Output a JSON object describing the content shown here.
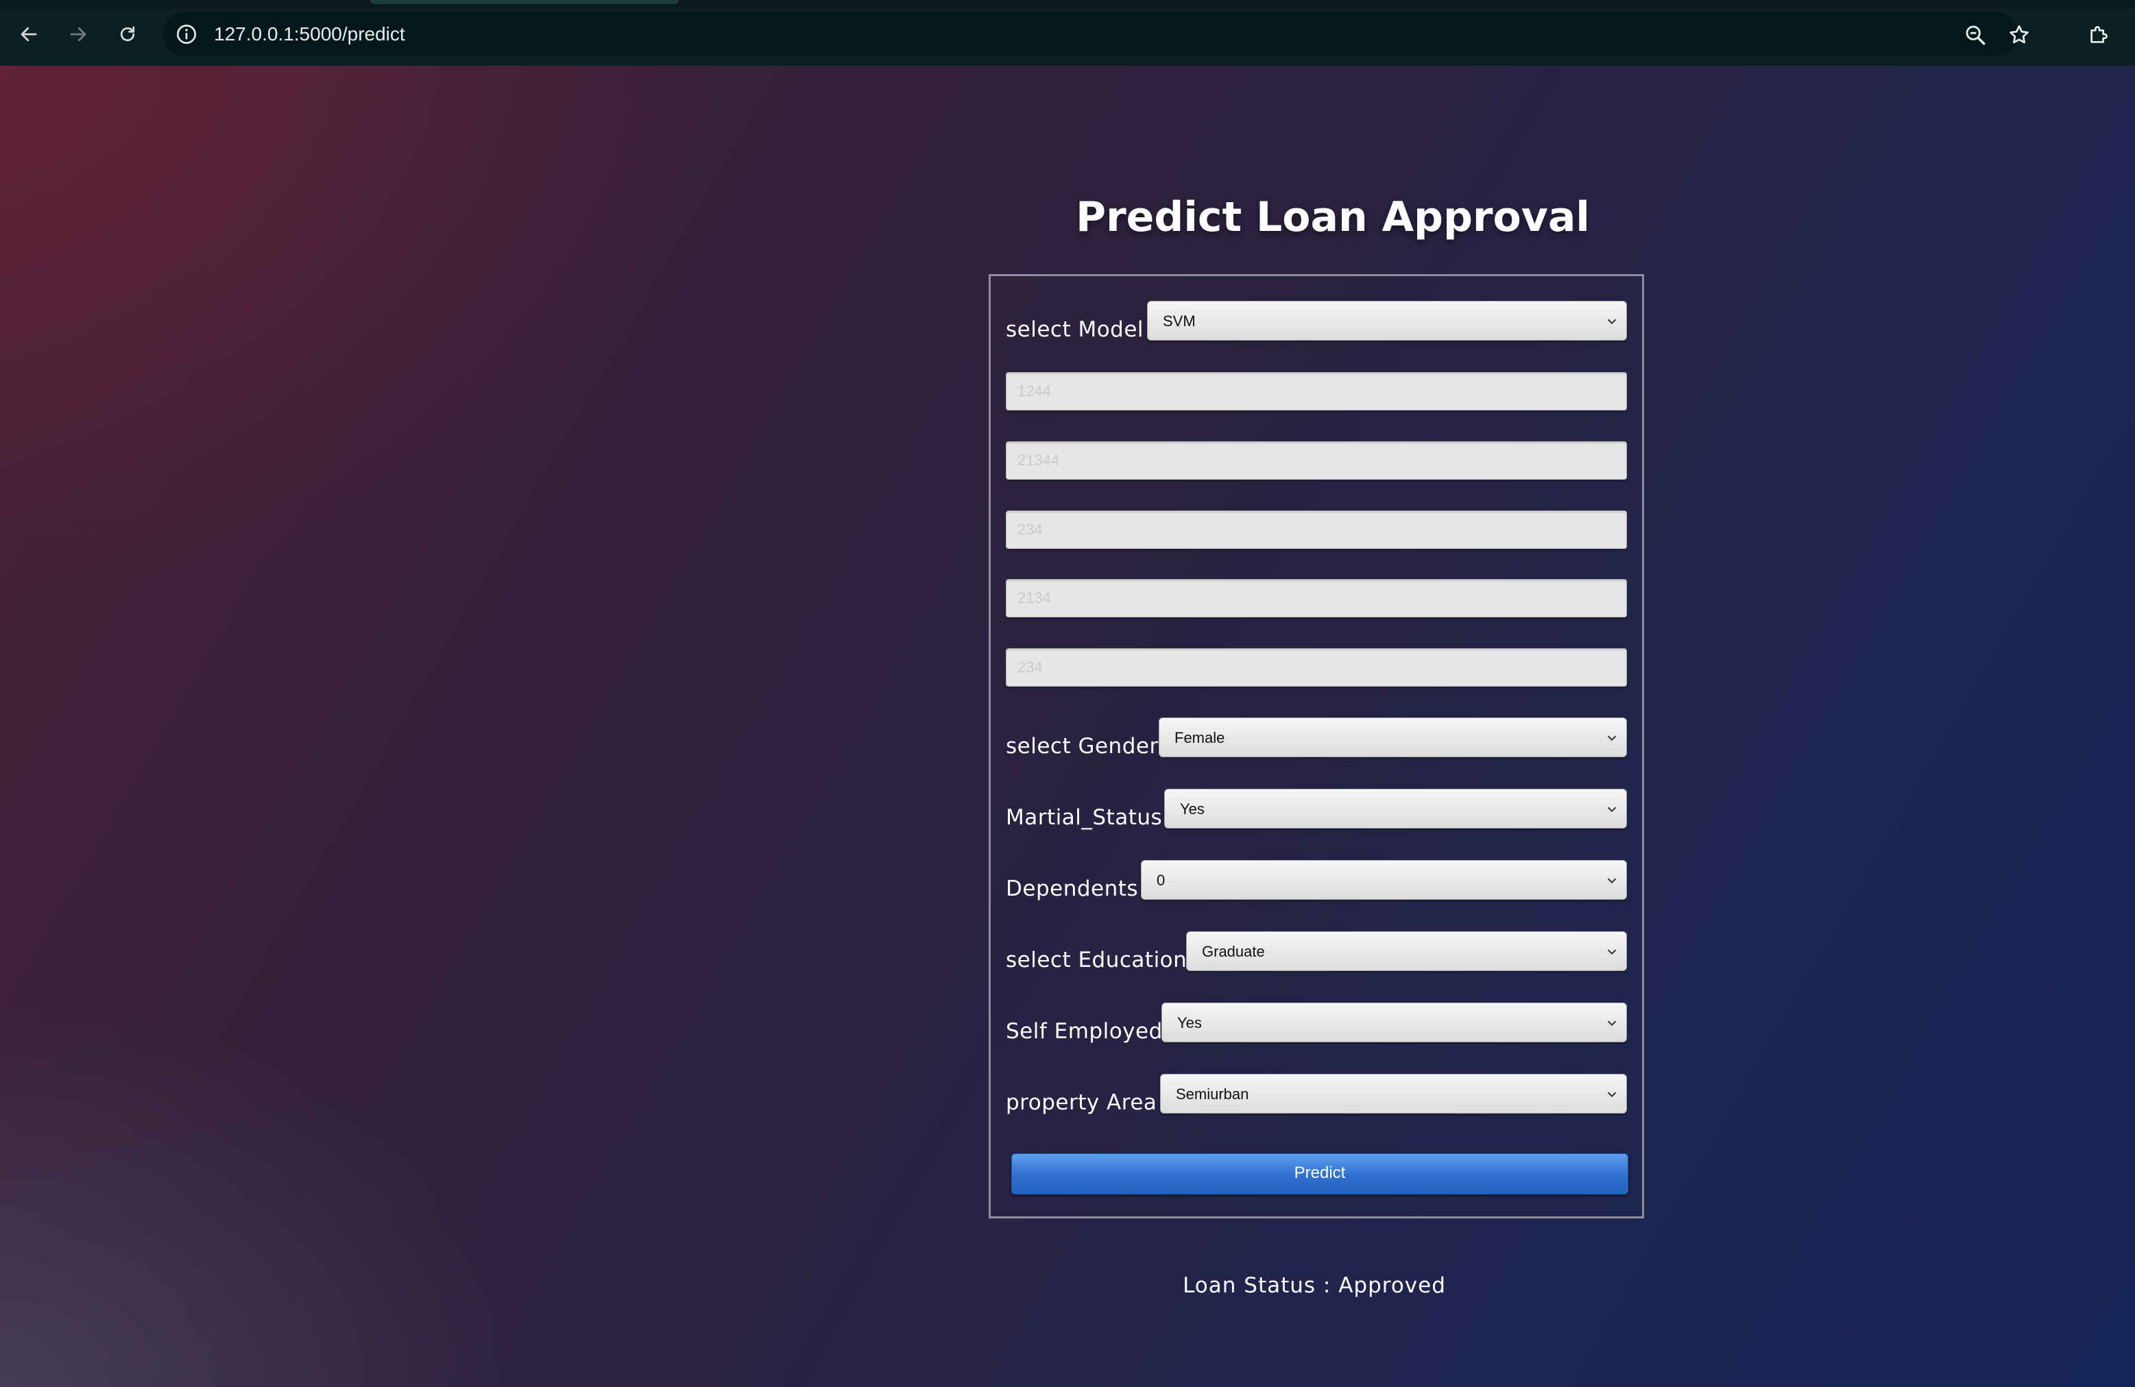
{
  "browser": {
    "url": "127.0.0.1:5000/predict"
  },
  "page": {
    "title": "Predict Loan Approval"
  },
  "form": {
    "model": {
      "label": "select Model",
      "value": "SVM"
    },
    "numeric_inputs": [
      {
        "placeholder": "1244"
      },
      {
        "placeholder": "21344"
      },
      {
        "placeholder": "234"
      },
      {
        "placeholder": "2134"
      },
      {
        "placeholder": "234"
      }
    ],
    "gender": {
      "label": "select Gender",
      "value": "Female"
    },
    "marital": {
      "label": "Martial_Status",
      "value": "Yes"
    },
    "dependents": {
      "label": "Dependents",
      "value": "0"
    },
    "education": {
      "label": "select Education",
      "value": "Graduate"
    },
    "self_employed": {
      "label": "Self Employed",
      "value": "Yes"
    },
    "property_area": {
      "label": "property Area",
      "value": "Semiurban"
    },
    "predict_label": "Predict"
  },
  "result": {
    "status_text": "Loan Status : Approved"
  },
  "icons": {
    "back": "arrow-left-icon",
    "forward": "arrow-right-icon",
    "reload": "reload-icon",
    "site_info": "info-icon",
    "zoom": "zoom-icon",
    "bookmark": "star-icon",
    "extensions": "puzzle-icon",
    "select_arrow": "chevron-down-icon"
  },
  "colors": {
    "chrome_bg": "#0c1f22",
    "omnibox_bg": "#04171a",
    "button_blue": "#2f6fcf",
    "text_white": "#ffffff"
  }
}
